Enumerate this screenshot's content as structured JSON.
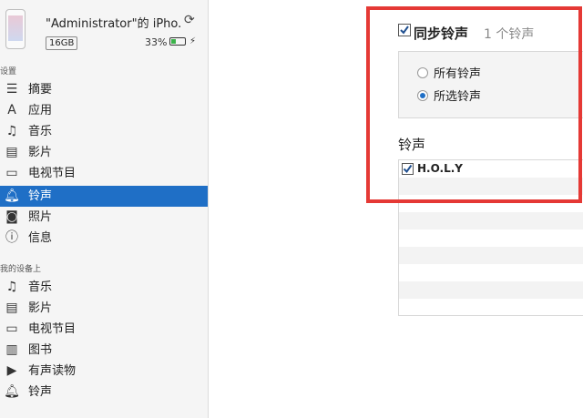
{
  "device": {
    "name": "\"Administrator\"的 iPho...",
    "capacity": "16GB",
    "battery_percent": "33%",
    "battery_level": 0.33
  },
  "sidebar": {
    "settings_section": "设置",
    "settings_items": [
      {
        "label": "摘要",
        "icon": "summary-icon"
      },
      {
        "label": "应用",
        "icon": "apps-icon"
      },
      {
        "label": "音乐",
        "icon": "music-icon"
      },
      {
        "label": "影片",
        "icon": "film-icon"
      },
      {
        "label": "电视节目",
        "icon": "tv-icon"
      },
      {
        "label": "铃声",
        "icon": "bell-icon",
        "selected": true
      },
      {
        "label": "照片",
        "icon": "camera-icon"
      },
      {
        "label": "信息",
        "icon": "info-icon"
      }
    ],
    "device_section": "我的设备上",
    "device_items": [
      {
        "label": "音乐",
        "icon": "music-icon"
      },
      {
        "label": "影片",
        "icon": "film-icon"
      },
      {
        "label": "电视节目",
        "icon": "tv-icon"
      },
      {
        "label": "图书",
        "icon": "book-icon"
      },
      {
        "label": "有声读物",
        "icon": "audiobook-icon"
      },
      {
        "label": "铃声",
        "icon": "bell-icon"
      }
    ]
  },
  "main": {
    "sync_label": "同步铃声",
    "sync_count": "1 个铃声",
    "sync_checked": true,
    "options": [
      {
        "label": "所有铃声",
        "selected": false
      },
      {
        "label": "所选铃声",
        "selected": true
      }
    ],
    "list_title": "铃声",
    "tones": [
      {
        "label": "H.O.L.Y",
        "checked": true
      }
    ]
  },
  "colors": {
    "accent": "#1f6fc6",
    "highlight": "#e53935"
  }
}
